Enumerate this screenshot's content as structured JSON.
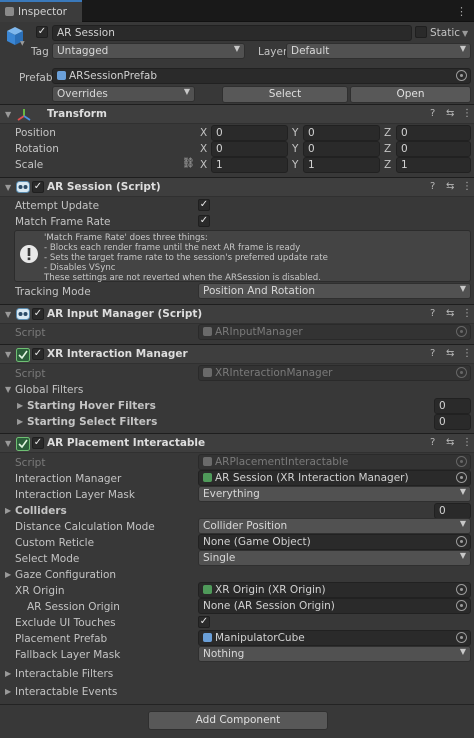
{
  "tab": {
    "label": "Inspector"
  },
  "gameobject": {
    "name": "AR Session",
    "static_label": "Static",
    "tag_label": "Tag",
    "tag_value": "Untagged",
    "layer_label": "Layer",
    "layer_value": "Default",
    "prefab_label": "Prefab",
    "prefab_value": "ARSessionPrefab",
    "overrides_label": "Overrides",
    "select_label": "Select",
    "open_label": "Open"
  },
  "transform": {
    "title": "Transform",
    "position_label": "Position",
    "rotation_label": "Rotation",
    "scale_label": "Scale",
    "position": [
      "0",
      "0",
      "0"
    ],
    "rotation": [
      "0",
      "0",
      "0"
    ],
    "scale": [
      "1",
      "1",
      "1"
    ],
    "x": "X",
    "y": "Y",
    "z": "Z"
  },
  "ar_session": {
    "title": "AR Session (Script)",
    "attempt_update_label": "Attempt Update",
    "match_frame_rate_label": "Match Frame Rate",
    "info_lines": [
      "'Match Frame Rate' does three things:",
      "- Blocks each render frame until the next AR frame is ready",
      "- Sets the target frame rate to the session's preferred update rate",
      "- Disables VSync",
      "These settings are not reverted when the ARSession is disabled."
    ],
    "tracking_mode_label": "Tracking Mode",
    "tracking_mode_value": "Position And Rotation"
  },
  "ar_input_manager": {
    "title": "AR Input Manager (Script)",
    "script_label": "Script",
    "script_value": "ARInputManager"
  },
  "xr_interaction_manager": {
    "title": "XR Interaction Manager",
    "script_label": "Script",
    "script_value": "XRInteractionManager",
    "global_filters_label": "Global Filters",
    "starting_hover_label": "Starting Hover Filters",
    "starting_hover_value": "0",
    "starting_select_label": "Starting Select Filters",
    "starting_select_value": "0"
  },
  "ar_placement": {
    "title": "AR Placement Interactable",
    "script_label": "Script",
    "script_value": "ARPlacementInteractable",
    "interaction_manager_label": "Interaction Manager",
    "interaction_manager_value": "AR Session (XR Interaction Manager)",
    "interaction_layer_mask_label": "Interaction Layer Mask",
    "interaction_layer_mask_value": "Everything",
    "colliders_label": "Colliders",
    "colliders_value": "0",
    "distance_calc_label": "Distance Calculation Mode",
    "distance_calc_value": "Collider Position",
    "custom_reticle_label": "Custom Reticle",
    "custom_reticle_value": "None (Game Object)",
    "select_mode_label": "Select Mode",
    "select_mode_value": "Single",
    "gaze_config_label": "Gaze Configuration",
    "xr_origin_label": "XR Origin",
    "xr_origin_value": "XR Origin (XR Origin)",
    "ar_session_origin_label": "AR Session Origin",
    "ar_session_origin_value": "None (AR Session Origin)",
    "exclude_ui_label": "Exclude UI Touches",
    "placement_prefab_label": "Placement Prefab",
    "placement_prefab_value": "ManipulatorCube",
    "fallback_layer_label": "Fallback Layer Mask",
    "fallback_layer_value": "Nothing",
    "interactable_filters_label": "Interactable Filters",
    "interactable_events_label": "Interactable Events"
  },
  "add_component_label": "Add Component",
  "icons": {
    "help": "?",
    "settings": "⇆",
    "more": "⋮",
    "check": "✓",
    "arrow_down": "▼",
    "arrow_right": "▶",
    "link": "⛓"
  }
}
